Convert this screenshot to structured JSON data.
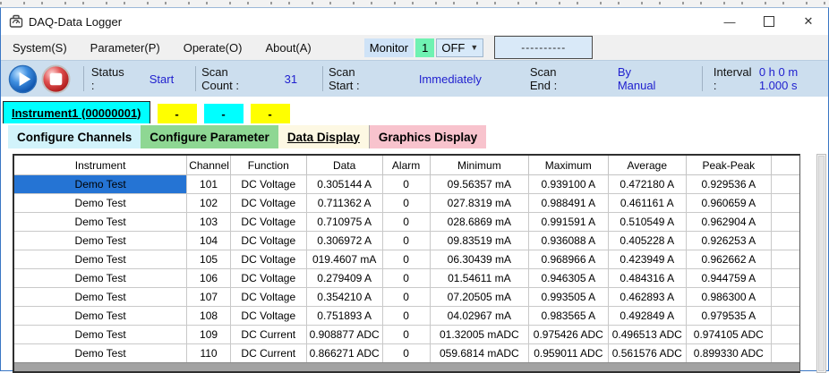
{
  "window": {
    "title": "DAQ-Data Logger",
    "minimize_glyph": "—",
    "close_glyph": "✕"
  },
  "menu": {
    "items": [
      {
        "label": "System(S)"
      },
      {
        "label": "Parameter(P)"
      },
      {
        "label": "Operate(O)"
      },
      {
        "label": "About(A)"
      }
    ],
    "monitor": {
      "label": "Monitor",
      "count": "1",
      "state": "OFF",
      "dashes_button": "----------"
    }
  },
  "toolbar": {
    "status_label": "Status :",
    "status_value": "Start",
    "scan_count_label": "Scan Count :",
    "scan_count_value": "31",
    "scan_start_label": "Scan Start :",
    "scan_start_value": "Immediately",
    "scan_end_label": "Scan End :",
    "scan_end_value": "By Manual",
    "interval_label": "Interval :",
    "interval_value": "0 h 0 m 1.000 s"
  },
  "instrument_tabs": {
    "active_label": "Instrument1 (00000001)",
    "placeholders": [
      "-",
      "-",
      "-"
    ]
  },
  "view_tabs": {
    "channels": "Configure Channels",
    "parameter": "Configure Parameter",
    "data": "Data Display",
    "graphics": "Graphics Display",
    "selected": "Data Display"
  },
  "table": {
    "columns": [
      "Instrument",
      "Channel",
      "Function",
      "Data",
      "Alarm",
      "Minimum",
      "Maximum",
      "Average",
      "Peak-Peak"
    ],
    "column_keys": [
      "instrument",
      "channel",
      "function",
      "data",
      "alarm",
      "minimum",
      "maximum",
      "average",
      "peak-peak"
    ],
    "selected_cell": {
      "row": 0,
      "col": 0
    },
    "rows": [
      [
        "Demo Test",
        "101",
        "DC Voltage",
        "0.305144 A",
        "0",
        "09.56357 mA",
        "0.939100 A",
        "0.472180 A",
        "0.929536 A"
      ],
      [
        "Demo Test",
        "102",
        "DC Voltage",
        "0.711362 A",
        "0",
        "027.8319 mA",
        "0.988491 A",
        "0.461161 A",
        "0.960659 A"
      ],
      [
        "Demo Test",
        "103",
        "DC Voltage",
        "0.710975 A",
        "0",
        "028.6869 mA",
        "0.991591 A",
        "0.510549 A",
        "0.962904 A"
      ],
      [
        "Demo Test",
        "104",
        "DC Voltage",
        "0.306972 A",
        "0",
        "09.83519 mA",
        "0.936088 A",
        "0.405228 A",
        "0.926253 A"
      ],
      [
        "Demo Test",
        "105",
        "DC Voltage",
        "019.4607 mA",
        "0",
        "06.30439 mA",
        "0.968966 A",
        "0.423949 A",
        "0.962662 A"
      ],
      [
        "Demo Test",
        "106",
        "DC Voltage",
        "0.279409 A",
        "0",
        "01.54611 mA",
        "0.946305 A",
        "0.484316 A",
        "0.944759 A"
      ],
      [
        "Demo Test",
        "107",
        "DC Voltage",
        "0.354210 A",
        "0",
        "07.20505 mA",
        "0.993505 A",
        "0.462893 A",
        "0.986300 A"
      ],
      [
        "Demo Test",
        "108",
        "DC Voltage",
        "0.751893 A",
        "0",
        "04.02967 mA",
        "0.983565 A",
        "0.492849 A",
        "0.979535 A"
      ],
      [
        "Demo Test",
        "109",
        "DC Current",
        "0.908877 ADC",
        "0",
        "01.32005 mADC",
        "0.975426 ADC",
        "0.496513 ADC",
        "0.974105 ADC"
      ],
      [
        "Demo Test",
        "110",
        "DC Current",
        "0.866271 ADC",
        "0",
        "059.6814 mADC",
        "0.959011 ADC",
        "0.561576 ADC",
        "0.899330 ADC"
      ]
    ]
  },
  "colors": {
    "toolbar_bg": "#ccdeee",
    "value_blue": "#2121cf",
    "selection_blue": "#2574d4",
    "tab_cyan": "#00ffff",
    "tab_yellow": "#ffff00",
    "tab_channels_bg": "#d2f3fb",
    "tab_parameter_bg": "#8ed793",
    "tab_data_bg": "#fdf8e3",
    "tab_graphics_bg": "#f8c3cd",
    "monitor_count_bg": "#6ff2b2"
  }
}
